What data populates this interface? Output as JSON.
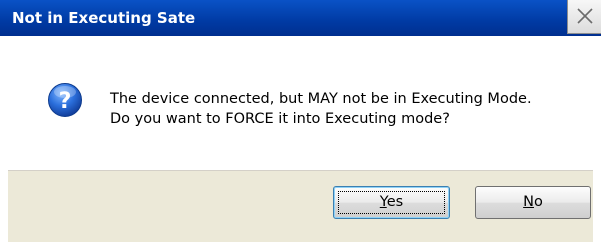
{
  "window": {
    "title": "Not in Executing Sate",
    "close_icon": "close-icon"
  },
  "message": {
    "icon": "question-icon",
    "line1": "The device connected, but MAY not be in Executing Mode.",
    "line2": "Do you want to FORCE it into Executing mode?"
  },
  "buttons": {
    "yes": {
      "mnemonic": "Y",
      "rest": "es",
      "default": true
    },
    "no": {
      "mnemonic": "N",
      "rest": "o",
      "default": false
    }
  },
  "colors": {
    "titlebar": "#003aa3",
    "title_text": "#ffffff",
    "footer": "#ece9d8",
    "question_icon": "#1e5fcf"
  }
}
